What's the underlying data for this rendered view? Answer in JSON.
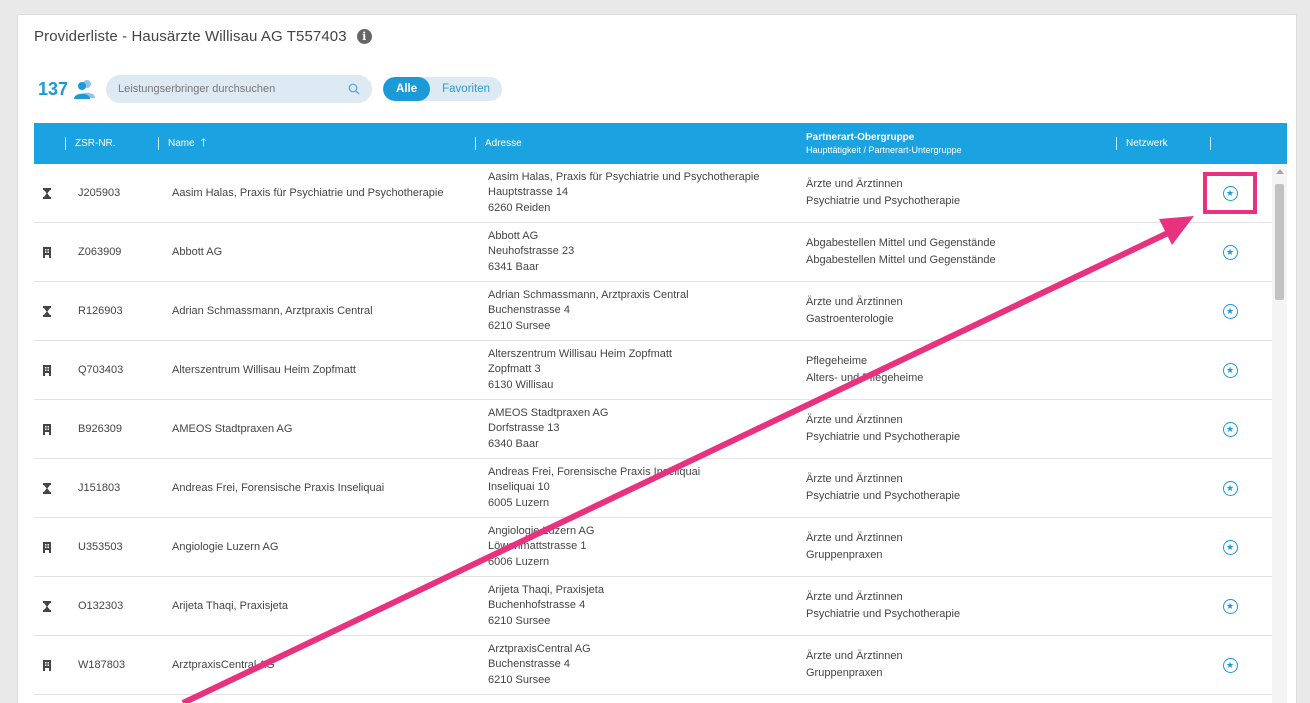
{
  "title": "Providerliste - Hausärzte Willisau AG T557403",
  "count": "137",
  "search": {
    "placeholder": "Leistungserbringer durchsuchen"
  },
  "filter": {
    "all": "Alle",
    "favorites": "Favoriten"
  },
  "columns": {
    "zsr": "ZSR-NR.",
    "name": "Name",
    "address": "Adresse",
    "partner_main": "Partnerart-Obergruppe",
    "partner_sub": "Haupttätigkeit / Partnerart-Untergruppe",
    "network": "Netzwerk"
  },
  "rows": [
    {
      "type": "person",
      "zsr": "J205903",
      "name": "Aasim Halas, Praxis für Psychiatrie und Psychotherapie",
      "addr1": "Aasim Halas, Praxis für Psychiatrie und Psychotherapie",
      "addr2": "Hauptstrasse 14",
      "addr3": "6260 Reiden",
      "partner1": "Ärzte und Ärztinnen",
      "partner2": "Psychiatrie und Psychotherapie"
    },
    {
      "type": "building",
      "zsr": "Z063909",
      "name": "Abbott AG",
      "addr1": "Abbott AG",
      "addr2": "Neuhofstrasse 23",
      "addr3": "6341 Baar",
      "partner1": "Abgabestellen Mittel und Gegenstände",
      "partner2": "Abgabestellen Mittel und Gegenstände"
    },
    {
      "type": "person",
      "zsr": "R126903",
      "name": "Adrian Schmassmann, Arztpraxis Central",
      "addr1": "Adrian Schmassmann, Arztpraxis Central",
      "addr2": "Buchenstrasse 4",
      "addr3": "6210 Sursee",
      "partner1": "Ärzte und Ärztinnen",
      "partner2": "Gastroenterologie"
    },
    {
      "type": "building",
      "zsr": "Q703403",
      "name": "Alterszentrum Willisau Heim Zopfmatt",
      "addr1": "Alterszentrum Willisau Heim Zopfmatt",
      "addr2": "Zopfmatt 3",
      "addr3": "6130 Willisau",
      "partner1": "Pflegeheime",
      "partner2": "Alters- und Pflegeheime"
    },
    {
      "type": "building",
      "zsr": "B926309",
      "name": "AMEOS Stadtpraxen AG",
      "addr1": "AMEOS Stadtpraxen AG",
      "addr2": "Dorfstrasse 13",
      "addr3": "6340 Baar",
      "partner1": "Ärzte und Ärztinnen",
      "partner2": "Psychiatrie und Psychotherapie"
    },
    {
      "type": "person",
      "zsr": "J151803",
      "name": "Andreas Frei, Forensische Praxis Inseliquai",
      "addr1": "Andreas Frei, Forensische Praxis Inseliquai",
      "addr2": "Inseliquai 10",
      "addr3": "6005 Luzern",
      "partner1": "Ärzte und Ärztinnen",
      "partner2": "Psychiatrie und Psychotherapie"
    },
    {
      "type": "building",
      "zsr": "U353503",
      "name": "Angiologie Luzern AG",
      "addr1": "Angiologie Luzern AG",
      "addr2": "Löwenmattstrasse 1",
      "addr3": "6006 Luzern",
      "partner1": "Ärzte und Ärztinnen",
      "partner2": "Gruppenpraxen"
    },
    {
      "type": "person",
      "zsr": "O132303",
      "name": "Arijeta Thaqi, Praxisjeta",
      "addr1": "Arijeta Thaqi, Praxisjeta",
      "addr2": "Buchenhofstrasse 4",
      "addr3": "6210 Sursee",
      "partner1": "Ärzte und Ärztinnen",
      "partner2": "Psychiatrie und Psychotherapie"
    },
    {
      "type": "building",
      "zsr": "W187803",
      "name": "ArztpraxisCentral AG",
      "addr1": "ArztpraxisCentral AG",
      "addr2": "Buchenstrasse 4",
      "addr3": "6210 Sursee",
      "partner1": "Ärzte und Ärztinnen",
      "partner2": "Gruppenpraxen"
    }
  ],
  "icons": {
    "info": "info-icon",
    "people": "people-icon",
    "search": "search-icon",
    "sort": "arrow-up-icon",
    "favorite": "star-circle-icon",
    "person": "person-icon",
    "building": "building-icon"
  },
  "colors": {
    "accent": "#1ba2e0",
    "annotation": "#e8327f"
  }
}
